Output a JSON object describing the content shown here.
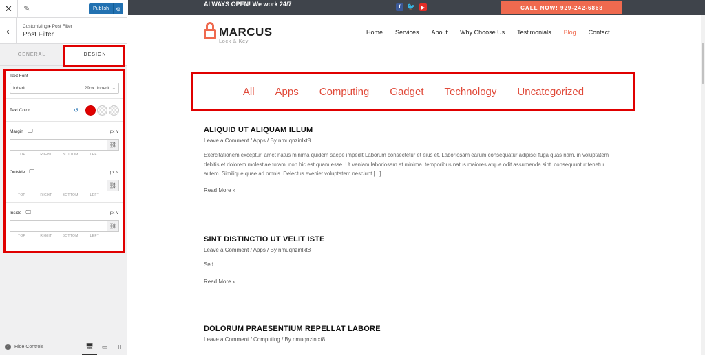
{
  "customizer": {
    "publish_label": "Publish",
    "breadcrumb": "Customizing ▸ Post Filter",
    "section_title": "Post Filter",
    "tabs": [
      "GENERAL",
      "DESIGN"
    ],
    "active_tab": "DESIGN",
    "text_font": {
      "label": "Text Font",
      "family": "Inherit",
      "size": "29px",
      "weight": "inherit"
    },
    "text_color": {
      "label": "Text Color",
      "value": "#e00000"
    },
    "spacing": [
      {
        "label": "Margin",
        "unit": "px ∨"
      },
      {
        "label": "Outside",
        "unit": "px ∨"
      },
      {
        "label": "Inside",
        "unit": "px ∨"
      }
    ],
    "side_labels": [
      "TOP",
      "RIGHT",
      "BOTTOM",
      "LEFT"
    ],
    "hide_controls_label": "Hide Controls",
    "devices": [
      "desktop",
      "tablet",
      "mobile"
    ]
  },
  "site": {
    "topbar_text": "ALWAYS OPEN! We work 24/7",
    "call_button": "CALL NOW! 929-242-6868",
    "logo_name": "MARCUS",
    "logo_sub": "Lock & Key",
    "nav": [
      "Home",
      "Services",
      "About",
      "Why Choose Us",
      "Testimonials",
      "Blog",
      "Contact"
    ],
    "current_nav": "Blog",
    "filter_categories": [
      "All",
      "Apps",
      "Computing",
      "Gadget",
      "Technology",
      "Uncategorized"
    ],
    "posts": [
      {
        "title": "ALIQUID UT ALIQUAM ILLUM",
        "meta": "Leave a Comment / Apps / By nmuqnzinlxt8",
        "excerpt": "Exercitationem excepturi amet natus minima quidem saepe impedit Laborum consectetur et eius et. Laboriosam earum consequatur adipisci fuga quas nam. in voluptatem debitis et dolorem molestiae totam. non hic est quam esse. Ut veniam laboriosam at minima. temporibus natus maiores atque odit assumenda sint. consequuntur tenetur autem. Similique quae ad omnis. Delectus eveniet voluptatem nesciunt [...]",
        "read_more": "Read More »"
      },
      {
        "title": "SINT DISTINCTIO UT VELIT ISTE",
        "meta": "Leave a Comment / Apps / By nmuqnzinlxt8",
        "excerpt": "Sed.",
        "read_more": "Read More »"
      },
      {
        "title": "DOLORUM PRAESENTIUM REPELLAT LABORE",
        "meta": "Leave a Comment / Computing / By nmuqnzinlxt8",
        "excerpt": "",
        "read_more": ""
      }
    ]
  },
  "colors": {
    "accent": "#ef6a4f",
    "highlight_box": "#e00000",
    "wp_blue": "#2271b1"
  }
}
